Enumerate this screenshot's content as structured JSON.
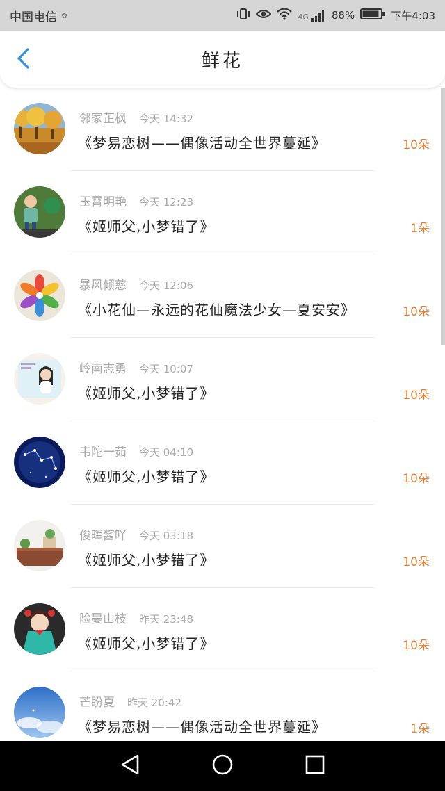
{
  "status_bar": {
    "carrier": "中国电信",
    "network": "4G",
    "battery": "88%",
    "time": "下午4:03"
  },
  "header": {
    "title": "鲜花",
    "back_icon": "chevron-left-icon",
    "accent_color": "#2d8ee6"
  },
  "colors": {
    "count": "#e0843a",
    "meta": "#a9a9a9",
    "title": "#222222"
  },
  "items": [
    {
      "name": "邻家芷枫",
      "time": "今天 14:32",
      "title": "《梦易恋树——偶像活动全世界蔓延》",
      "count": "10朵"
    },
    {
      "name": "玉霄明艳",
      "time": "今天 12:23",
      "title": "《姬师父,小梦错了》",
      "count": "1朵"
    },
    {
      "name": "暴风倾慈",
      "time": "今天 12:06",
      "title": "《小花仙—永远的花仙魔法少女—夏安安》",
      "count": "10朵"
    },
    {
      "name": "岭南志勇",
      "time": "今天 10:07",
      "title": "《姬师父,小梦错了》",
      "count": "10朵"
    },
    {
      "name": "韦陀一茹",
      "time": "今天 04:10",
      "title": "《姬师父,小梦错了》",
      "count": "10朵"
    },
    {
      "name": "俊晖酱吖",
      "time": "今天 03:18",
      "title": "《姬师父,小梦错了》",
      "count": "10朵"
    },
    {
      "name": "险晏山枝",
      "time": "昨天 23:48",
      "title": "《姬师父,小梦错了》",
      "count": "10朵"
    },
    {
      "name": "芒盼夏",
      "time": "昨天 20:42",
      "title": "《梦易恋树——偶像活动全世界蔓延》",
      "count": "1朵"
    }
  ],
  "nav": {
    "back_icon": "triangle-back-icon",
    "home_icon": "circle-home-icon",
    "recents_icon": "square-recents-icon"
  }
}
